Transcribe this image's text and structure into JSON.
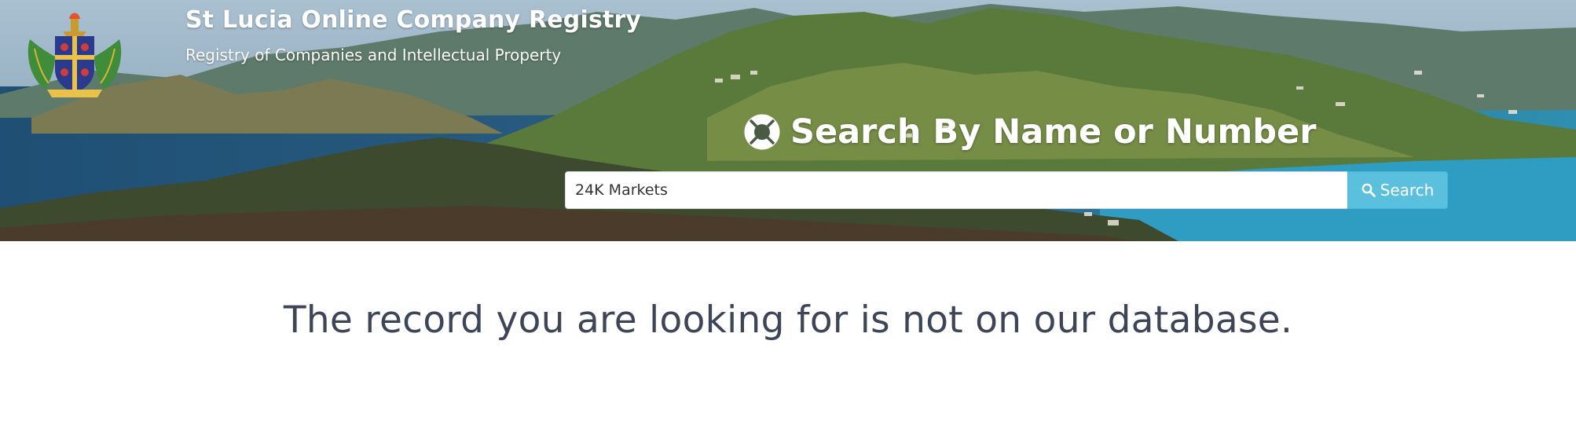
{
  "header": {
    "title": "St Lucia Online Company Registry",
    "subtitle": "Registry of Companies and Intellectual Property",
    "crest_icon": "coat-of-arms-icon"
  },
  "search": {
    "heading": "Search By Name or Number",
    "heading_icon": "lifebuoy-icon",
    "input_value": "24K Markets",
    "button_label": "Search",
    "button_icon": "search-icon",
    "button_color": "#5bc0de"
  },
  "result": {
    "message": "The record you are looking for is not on our database."
  },
  "colors": {
    "message_text": "#3d4557",
    "header_text": "#ffffff"
  }
}
